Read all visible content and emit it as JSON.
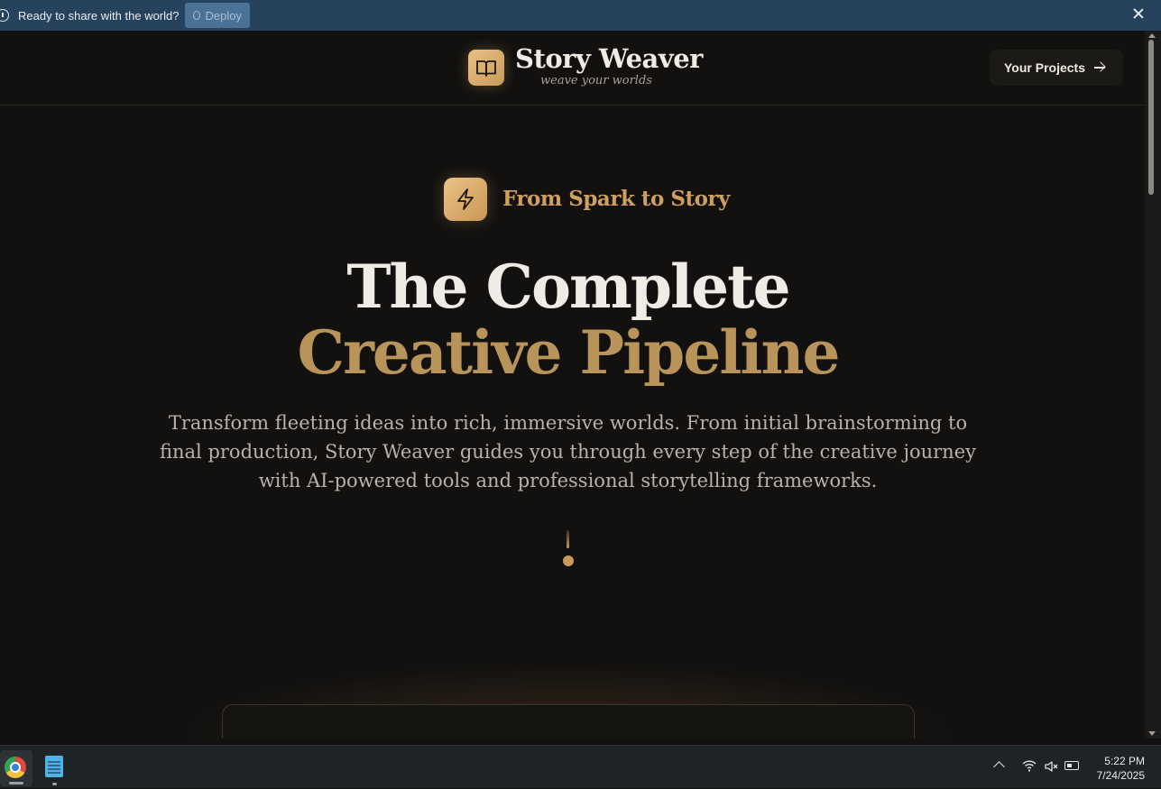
{
  "banner": {
    "message": "Ready to share with the world?",
    "deploy_label": "Deploy"
  },
  "header": {
    "brand_title": "Story Weaver",
    "brand_tagline": "weave your worlds",
    "projects_button": "Your Projects"
  },
  "hero": {
    "eyebrow": "From Spark to Story",
    "title_line1": "The Complete",
    "title_line2": "Creative Pipeline",
    "description": "Transform fleeting ideas into rich, immersive worlds. From initial brainstorming to final production, Story Weaver guides you through every step of the creative journey with AI-powered tools and professional storytelling frameworks."
  },
  "taskbar": {
    "apps": [
      "chrome-icon",
      "notepad-icon"
    ],
    "time": "5:22 PM",
    "date": "7/24/2025"
  },
  "colors": {
    "background": "#121110",
    "accent_gold": "#b8935a",
    "banner_bg": "#26425c"
  }
}
